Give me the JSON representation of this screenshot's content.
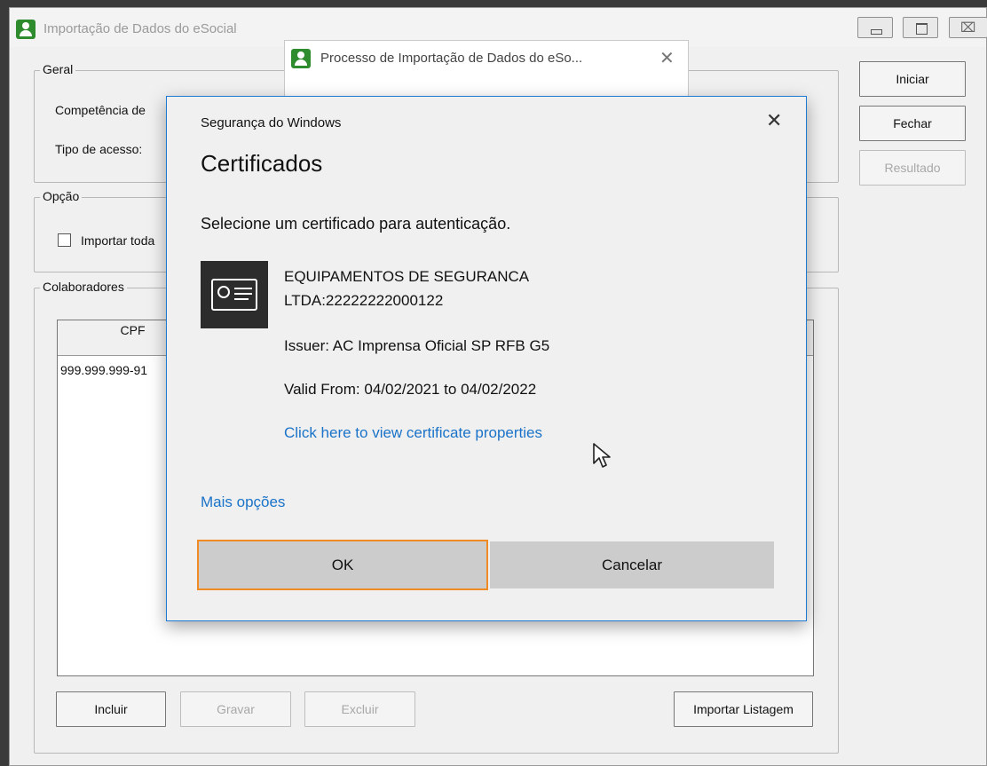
{
  "main_window": {
    "title": "Importação de Dados do eSocial",
    "buttons": {
      "iniciar": "Iniciar",
      "fechar": "Fechar",
      "resultado": "Resultado"
    },
    "geral": {
      "title": "Geral",
      "competencia_label": "Competência de",
      "tipo_acesso_label": "Tipo de acesso:"
    },
    "opcao": {
      "title": "Opção",
      "importar_label": "Importar toda",
      "importar_checked": false
    },
    "colaboradores": {
      "title": "Colaboradores",
      "columns": [
        "CPF"
      ],
      "rows": [
        [
          "999.999.999-91"
        ]
      ],
      "buttons": {
        "incluir": "Incluir",
        "gravar": "Gravar",
        "excluir": "Excluir",
        "importar_listagem": "Importar Listagem"
      }
    }
  },
  "process_window": {
    "title": "Processo de Importação de Dados do eSo..."
  },
  "security_dialog": {
    "header": "Segurança do Windows",
    "title": "Certificados",
    "instruction": "Selecione um certificado para autenticação.",
    "certificate": {
      "name_line1": "EQUIPAMENTOS DE SEGURANCA",
      "name_line2": "LTDA:22222222000122",
      "issuer": "Issuer: AC Imprensa Oficial SP RFB G5",
      "valid": "Valid From: 04/02/2021 to 04/02/2022",
      "properties_link": "Click here to view certificate properties"
    },
    "more_options": "Mais opções",
    "ok_label": "OK",
    "cancel_label": "Cancelar"
  },
  "colors": {
    "link": "#1a73c8",
    "focus_border": "#f08a24",
    "dialog_border": "#1c78d0",
    "app_icon": "#2e8b2e"
  },
  "icons": {
    "app": "user-icon",
    "certificate": "certificate-icon",
    "close": "close-icon"
  }
}
